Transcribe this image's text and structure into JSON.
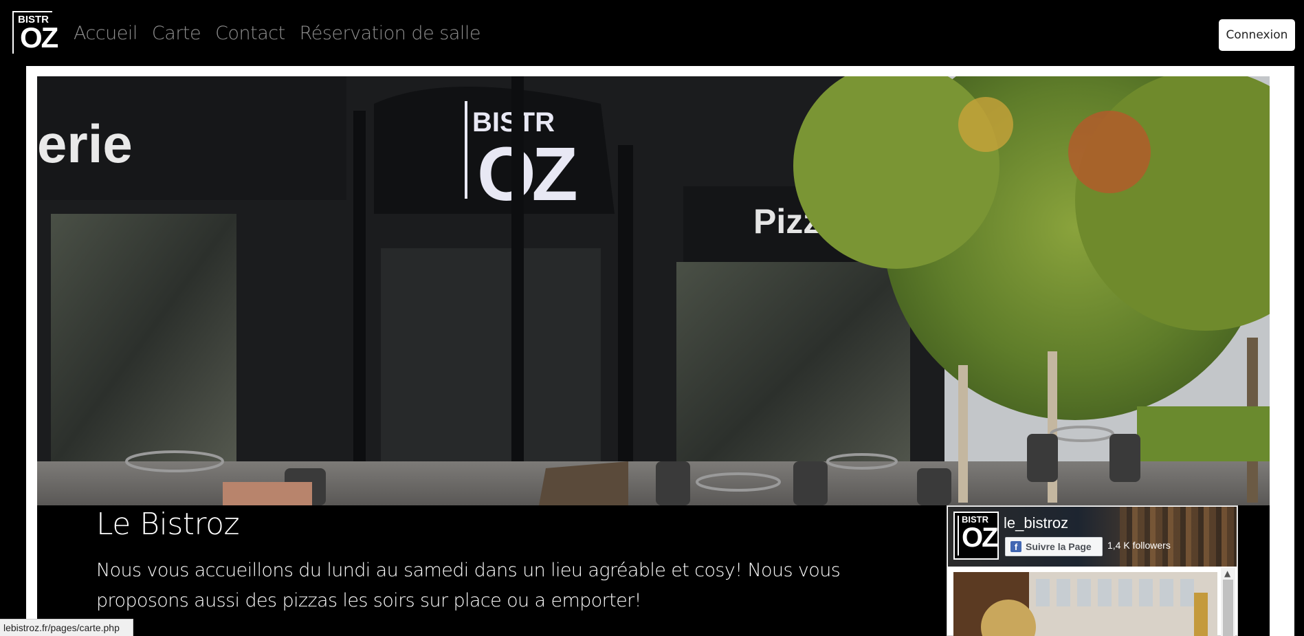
{
  "navbar": {
    "logo": {
      "line1": "BISTR",
      "line2": "OZ"
    },
    "links": [
      {
        "label": "Accueil"
      },
      {
        "label": "Carte"
      },
      {
        "label": "Contact"
      },
      {
        "label": "Réservation de salle"
      }
    ],
    "login_label": "Connexion"
  },
  "hero": {
    "image": "restaurant-storefront-photo",
    "storefront_sign_left": "erie",
    "storefront_sign_right": "Pizzeria",
    "storefront_logo": {
      "line1": "BISTR",
      "line2": "OZ"
    }
  },
  "main": {
    "title": "Le Bistroz",
    "intro": "Nous vous accueillons du lundi au samedi dans un lieu agréable et cosy! Nous vous proposons aussi des pizzas les soirs sur place ou a emporter!"
  },
  "facebook_widget": {
    "page_name": "le_bistroz",
    "avatar": {
      "line1": "BISTR",
      "line2": "OZ"
    },
    "follow_label": "Suivre la Page",
    "followers": "1,4 K followers",
    "icon": "facebook-icon"
  },
  "status_bar": {
    "url": "lebistroz.fr/pages/carte.php"
  },
  "colors": {
    "background": "#000000",
    "nav_link": "#8f8f8f",
    "frame": "#ffffff",
    "fb_blue": "#4267b2"
  }
}
